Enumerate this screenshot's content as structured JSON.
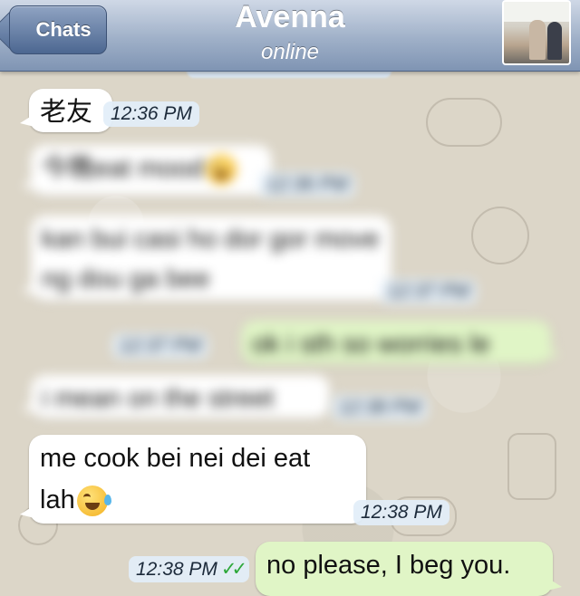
{
  "header": {
    "back_label": "Chats",
    "contact_name": "Avenna",
    "status": "online"
  },
  "messages": [
    {
      "direction": "in",
      "text": "老友",
      "time": "12:36 PM",
      "blurred": false
    },
    {
      "direction": "in",
      "text": "今晚eat mood",
      "time": "12:36 PM",
      "blurred": true
    },
    {
      "direction": "in",
      "text": "kan bui casi ho dor gor move ng dou ga bee",
      "time": "12:37 PM",
      "blurred": true
    },
    {
      "direction": "out",
      "text": "ok i sth so worries le",
      "time": "12:37 PM",
      "blurred": true
    },
    {
      "direction": "in",
      "text": "i mean on the street",
      "time": "12:38 PM",
      "blurred": true
    },
    {
      "direction": "in",
      "text_line1": "me cook bei nei dei eat",
      "text_line2": "lah",
      "time": "12:38 PM",
      "blurred": false
    },
    {
      "direction": "out",
      "text": "no please, I beg you.",
      "time": "12:38 PM",
      "blurred": false
    }
  ],
  "colors": {
    "navbar": "#9fb0c8",
    "incoming_bubble": "#ffffff",
    "outgoing_bubble": "#e0f5c6",
    "read_ticks": "#2ea83a"
  },
  "icons": {
    "read_receipt": "double-check-icon",
    "emoji": "tears-of-joy-emoji"
  }
}
